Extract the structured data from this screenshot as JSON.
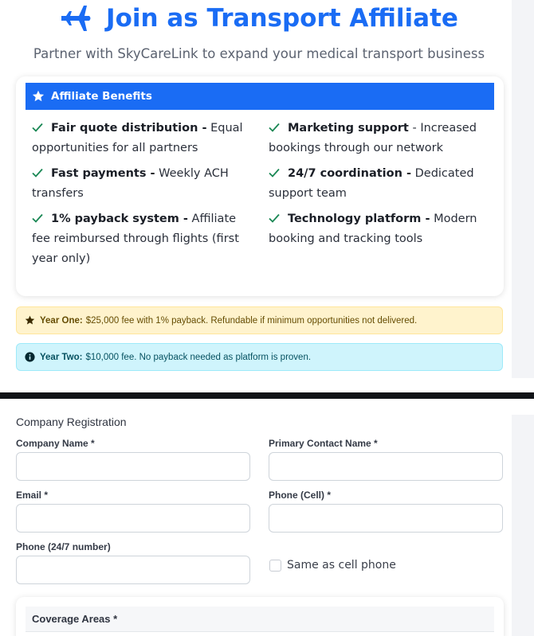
{
  "hero": {
    "title": "Join as Transport Affiliate",
    "subtitle": "Partner with SkyCareLink to expand your medical transport business",
    "icon": "plane-icon",
    "color": "#1a6cf4"
  },
  "benefits": {
    "header": "Affiliate Benefits",
    "icon": "star-icon",
    "items": [
      {
        "bold": "Fair quote distribution -",
        "text": " Equal opportunities for all partners"
      },
      {
        "bold": "Marketing support",
        "text": " - Increased bookings through our network"
      },
      {
        "bold": "Fast payments -",
        "text": " Weekly ACH transfers"
      },
      {
        "bold": "24/7 coordination -",
        "text": " Dedicated support team"
      },
      {
        "bold": "1% payback system -",
        "text": " Affiliate fee reimbursed through flights (first year only)"
      },
      {
        "bold": "Technology platform -",
        "text": " Modern booking and tracking tools"
      }
    ]
  },
  "alerts": {
    "year_one": {
      "label": "Year One:",
      "text": "$25,000 fee with 1% payback. Refundable if minimum opportunities not delivered."
    },
    "year_two": {
      "label": "Year Two:",
      "text": "$10,000 fee. No payback needed as platform is proven."
    }
  },
  "form": {
    "section_title": "Company Registration",
    "company_name_label": "Company Name *",
    "company_name_value": "",
    "primary_contact_label": "Primary Contact Name *",
    "primary_contact_value": "",
    "email_label": "Email *",
    "email_value": "",
    "phone_cell_label": "Phone (Cell) *",
    "phone_cell_value": "",
    "phone_247_label": "Phone (24/7 number)",
    "phone_247_value": "",
    "same_as_cell_label": "Same as cell phone",
    "same_as_cell_checked": false,
    "coverage_title": "Coverage Areas *"
  }
}
